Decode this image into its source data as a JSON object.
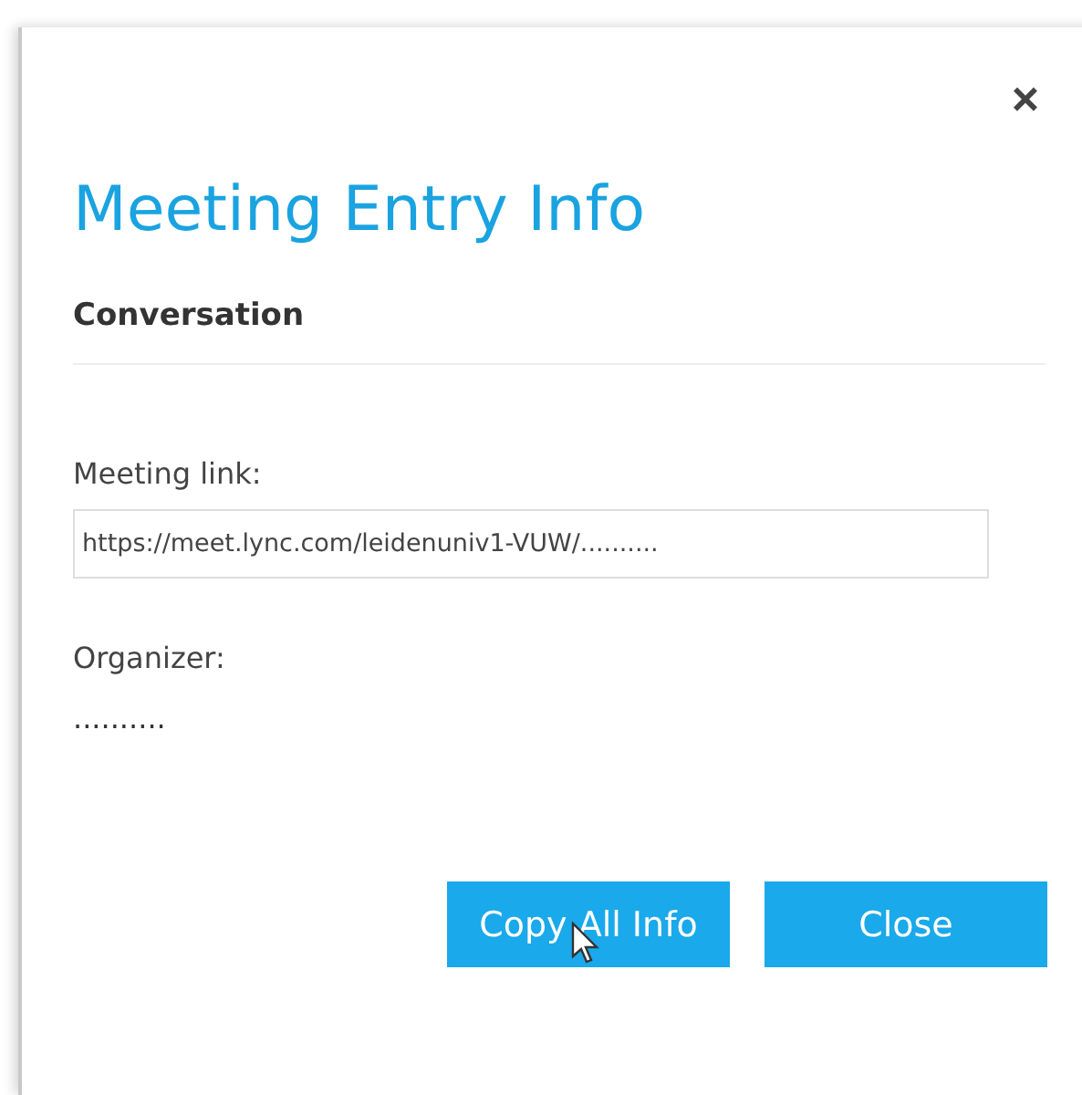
{
  "dialog": {
    "close_icon": "×",
    "title": "Meeting Entry Info",
    "section": "Conversation",
    "fields": [
      {
        "kind": "input",
        "label": "Meeting link:",
        "value": "https://meet.lync.com/leidenuniv1-VUW/.........."
      },
      {
        "kind": "text",
        "label": "Organizer:",
        "value": ".........."
      }
    ],
    "buttons": [
      "Copy All Info",
      "Close"
    ]
  }
}
